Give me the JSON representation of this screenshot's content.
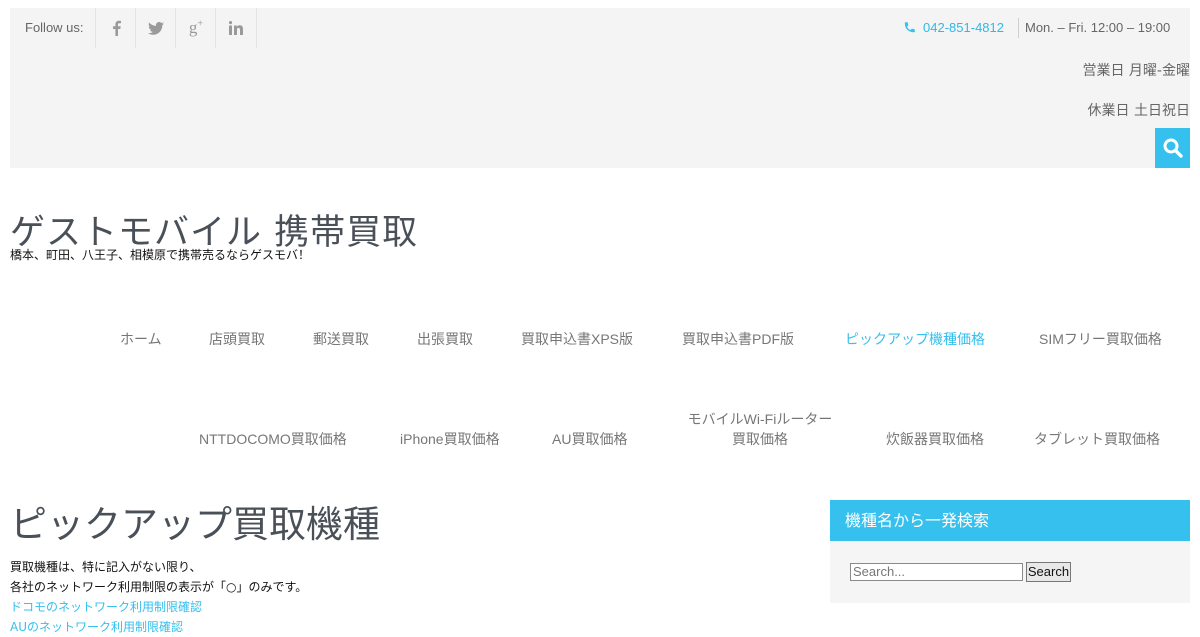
{
  "topbar": {
    "follow_label": "Follow us:",
    "social": [
      "facebook-icon",
      "twitter-icon",
      "google-plus-icon",
      "linkedin-icon"
    ],
    "phone": "042-851-4812",
    "hours": "Mon. – Fri. 12:00 – 19:00",
    "business_days": "営業日 月曜-金曜",
    "holidays": "休業日 土日祝日",
    "accent_color": "#35c0ee"
  },
  "site": {
    "title": "ゲストモバイル 携帯買取",
    "tagline": "橋本、町田、八王子、相模原で携帯売るならゲスモバ！"
  },
  "nav": {
    "row1": [
      "ホーム",
      "店頭買取",
      "郵送買取",
      "出張買取",
      "買取申込書XPS版",
      "買取申込書PDF版",
      "ピックアップ機種価格",
      "SIMフリー買取価格"
    ],
    "row2": [
      "NTTDOCOMO買取価格",
      "iPhone買取価格",
      "AU買取価格",
      "モバイルWi-Fiルーター",
      "買取価格",
      "炊飯器買取価格",
      "タブレット買取価格"
    ],
    "active": "ピックアップ機種価格"
  },
  "content": {
    "title": "ピックアップ買取機種",
    "line1": "買取機種は、特に記入がない限り、",
    "line2": "各社のネットワーク利用制限の表示が「○」のみです。",
    "link1": "ドコモのネットワーク利用制限確認",
    "link2": "AUのネットワーク利用制限確認"
  },
  "widget": {
    "title": "機種名から一発検索",
    "placeholder": "Search...",
    "button": "Search"
  }
}
